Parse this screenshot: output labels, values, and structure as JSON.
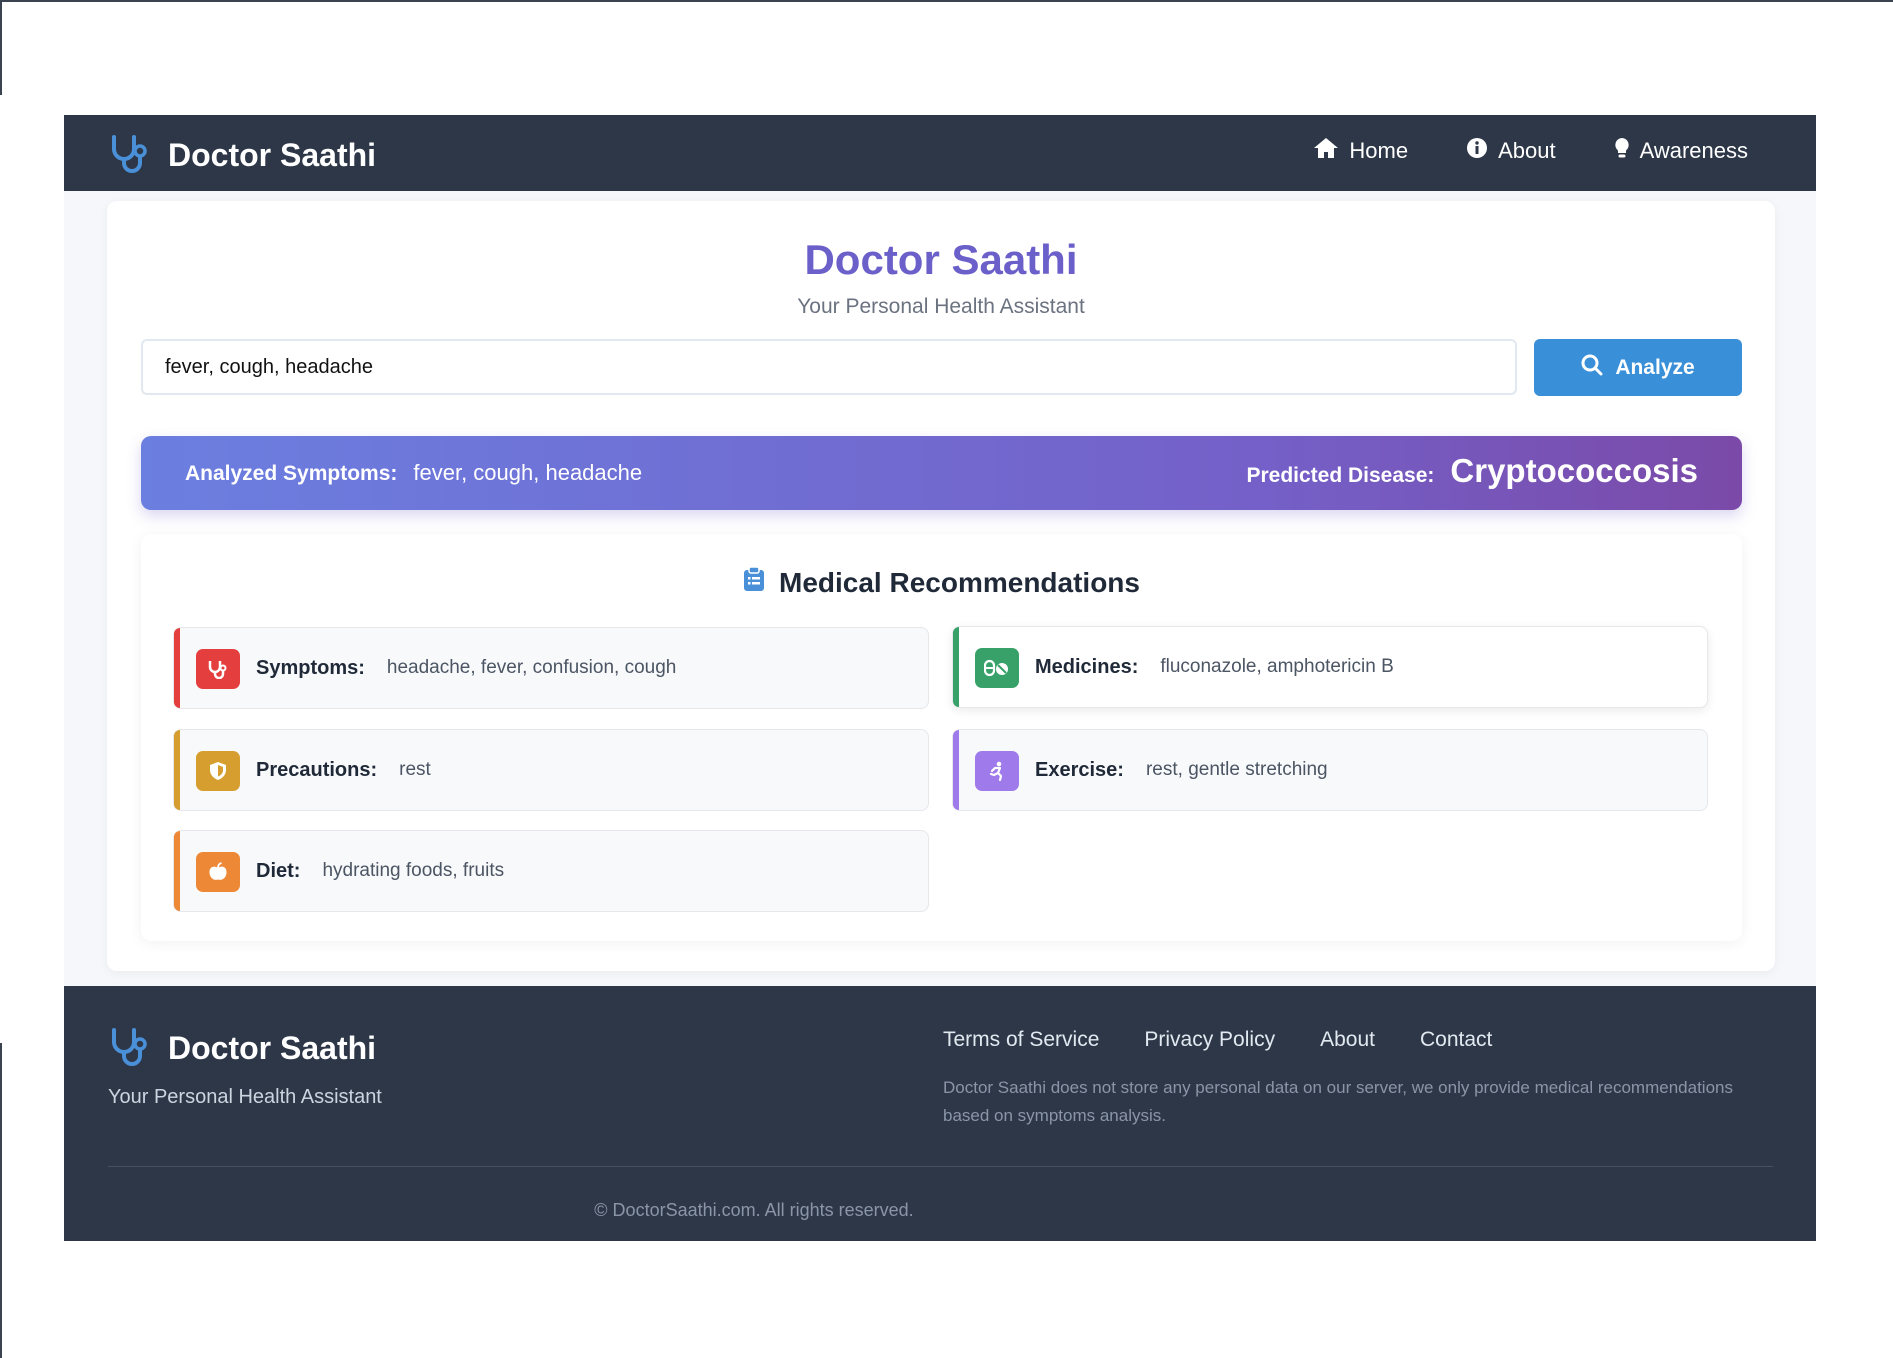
{
  "nav": {
    "brand": "Doctor Saathi",
    "links": [
      {
        "label": "Home",
        "icon": "home-icon"
      },
      {
        "label": "About",
        "icon": "info-icon"
      },
      {
        "label": "Awareness",
        "icon": "lightbulb-icon"
      }
    ]
  },
  "hero": {
    "title": "Doctor Saathi",
    "subtitle": "Your Personal Health Assistant"
  },
  "search": {
    "value": "fever, cough, headache",
    "button_label": "Analyze"
  },
  "result": {
    "symptoms_label": "Analyzed Symptoms:",
    "symptoms_value": "fever, cough, headache",
    "disease_label": "Predicted Disease:",
    "disease_value": "Cryptococcosis"
  },
  "recommendations": {
    "title": "Medical Recommendations",
    "items": [
      {
        "label": "Symptoms:",
        "value": "headache, fever, confusion, cough",
        "color": "#e53e3e",
        "icon": "stethoscope-icon"
      },
      {
        "label": "Medicines:",
        "value": "fluconazole, amphotericin B",
        "color": "#38a169",
        "icon": "pills-icon"
      },
      {
        "label": "Precautions:",
        "value": "rest",
        "color": "#d69e2e",
        "icon": "shield-icon"
      },
      {
        "label": "Exercise:",
        "value": "rest, gentle stretching",
        "color": "#9f7aea",
        "icon": "running-icon"
      },
      {
        "label": "Diet:",
        "value": "hydrating foods, fruits",
        "color": "#ed8936",
        "icon": "apple-icon"
      }
    ]
  },
  "footer": {
    "brand": "Doctor Saathi",
    "subtitle": "Your Personal Health Assistant",
    "links": [
      "Terms of Service",
      "Privacy Policy",
      "About",
      "Contact"
    ],
    "note": "Doctor Saathi does not store any personal data on our server, we only provide medical recommendations based on symptoms analysis.",
    "copyright": "© DoctorSaathi.com. All rights reserved."
  },
  "colors": {
    "navbar": "#2d3748",
    "accent": "#6b5fc9",
    "button": "#3a8fd9",
    "icon_blue": "#4a90d9"
  }
}
